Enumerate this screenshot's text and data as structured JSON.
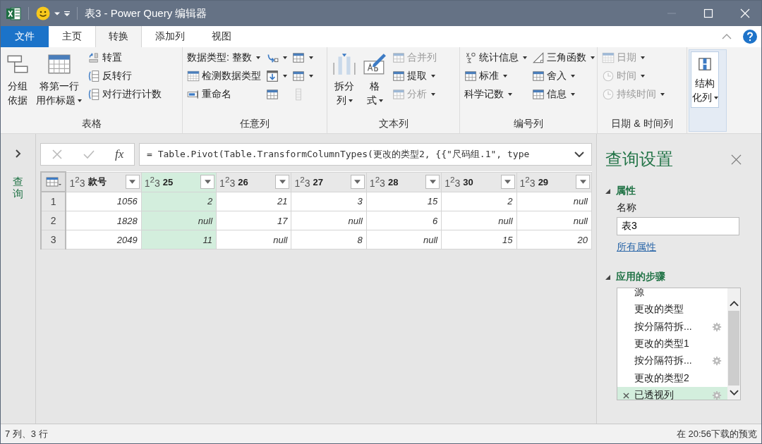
{
  "window": {
    "title": "表3 - Power Query 编辑器"
  },
  "tabs": [
    {
      "label": "文件",
      "kind": "file",
      "selected": false
    },
    {
      "label": "主页",
      "kind": "tab",
      "selected": false
    },
    {
      "label": "转换",
      "kind": "tab",
      "selected": true
    },
    {
      "label": "添加列",
      "kind": "tab",
      "selected": false
    },
    {
      "label": "视图",
      "kind": "tab",
      "selected": false
    }
  ],
  "ribbon": {
    "groups": [
      {
        "label": "表格",
        "highlighted": false,
        "columns": [
          [
            {
              "kind": "large",
              "lines": [
                "分组",
                "依据"
              ],
              "dropdown": false,
              "disabled": false
            }
          ],
          [
            {
              "kind": "large",
              "lines": [
                "将第一行",
                "用作标题"
              ],
              "dropdown": true,
              "disabled": false
            }
          ],
          [
            {
              "kind": "small",
              "label": "转置",
              "dropdown": false,
              "disabled": false
            },
            {
              "kind": "small",
              "label": "反转行",
              "dropdown": false,
              "disabled": false
            },
            {
              "kind": "small",
              "label": "对行进行计数",
              "dropdown": false,
              "disabled": false
            }
          ]
        ]
      },
      {
        "label": "任意列",
        "highlighted": false,
        "columns": [
          [
            {
              "kind": "small",
              "label": "数据类型: 整数",
              "dropdown": true,
              "disabled": false
            },
            {
              "kind": "small",
              "label": "检测数据类型",
              "dropdown": false,
              "disabled": false
            },
            {
              "kind": "small",
              "label": "重命名",
              "dropdown": false,
              "disabled": false
            }
          ],
          [
            {
              "kind": "icon",
              "dropdown": true,
              "disabled": false
            },
            {
              "kind": "icon",
              "dropdown": true,
              "disabled": false
            },
            {
              "kind": "icon",
              "dropdown": false,
              "disabled": false
            }
          ],
          [
            {
              "kind": "icon",
              "dropdown": true,
              "disabled": false
            },
            {
              "kind": "icon",
              "dropdown": true,
              "disabled": false
            },
            {
              "kind": "icon",
              "dropdown": false,
              "disabled": true
            }
          ]
        ]
      },
      {
        "label": "文本列",
        "highlighted": false,
        "columns": [
          [
            {
              "kind": "large",
              "lines": [
                "拆分",
                "列"
              ],
              "dropdown": true,
              "disabled": false
            }
          ],
          [
            {
              "kind": "large",
              "lines": [
                "格",
                "式"
              ],
              "dropdown": true,
              "disabled": false
            }
          ],
          [
            {
              "kind": "small",
              "label": "合并列",
              "dropdown": false,
              "disabled": true
            },
            {
              "kind": "small",
              "label": "提取",
              "dropdown": true,
              "disabled": false
            },
            {
              "kind": "small",
              "label": "分析",
              "dropdown": true,
              "disabled": true
            }
          ]
        ]
      },
      {
        "label": "编号列",
        "highlighted": false,
        "columns": [
          [
            {
              "kind": "small",
              "label": "统计信息",
              "dropdown": true,
              "disabled": false
            },
            {
              "kind": "small",
              "label": "标准",
              "dropdown": true,
              "disabled": false
            },
            {
              "kind": "small",
              "label": "科学记数",
              "dropdown": true,
              "disabled": false
            }
          ],
          [
            {
              "kind": "small",
              "label": "三角函数",
              "dropdown": true,
              "disabled": false
            },
            {
              "kind": "small",
              "label": "舍入",
              "dropdown": true,
              "disabled": false
            },
            {
              "kind": "small",
              "label": "信息",
              "dropdown": true,
              "disabled": false
            }
          ]
        ]
      },
      {
        "label": "日期 & 时间列",
        "highlighted": false,
        "columns": [
          [
            {
              "kind": "small",
              "label": "日期",
              "dropdown": true,
              "disabled": true
            },
            {
              "kind": "small",
              "label": "时间",
              "dropdown": true,
              "disabled": true
            },
            {
              "kind": "small",
              "label": "持续时间",
              "dropdown": true,
              "disabled": true
            }
          ]
        ]
      },
      {
        "highlighted": true,
        "columns": [
          [
            {
              "kind": "large",
              "lines": [
                "结构",
                "化列"
              ],
              "dropdown": true,
              "disabled": false
            }
          ]
        ]
      }
    ]
  },
  "queries_pane": {
    "label": "查询"
  },
  "formula_bar": {
    "fx": "fx",
    "formula": "= Table.Pivot(Table.TransformColumnTypes(更改的类型2, {{\"尺码组.1\", type"
  },
  "table": {
    "columns": [
      {
        "type_label": "1$^{2}$3",
        "name": "款号",
        "selected": false
      },
      {
        "type_label": "1$^{2}$3",
        "name": "25",
        "selected": true
      },
      {
        "type_label": "1$^{2}$3",
        "name": "26",
        "selected": false
      },
      {
        "type_label": "1$^{2}$3",
        "name": "27",
        "selected": false
      },
      {
        "type_label": "1$^{2}$3",
        "name": "28",
        "selected": false
      },
      {
        "type_label": "1$^{2}$3",
        "name": "30",
        "selected": false
      },
      {
        "type_label": "1$^{2}$3",
        "name": "29",
        "selected": false
      }
    ],
    "rows": [
      {
        "index": "1",
        "cells": [
          "1056",
          "2",
          "21",
          "3",
          "15",
          "2",
          "null"
        ]
      },
      {
        "index": "2",
        "cells": [
          "1828",
          "null",
          "17",
          "null",
          "6",
          "null",
          "null"
        ]
      },
      {
        "index": "3",
        "cells": [
          "2049",
          "11",
          "null",
          "8",
          "null",
          "15",
          "20"
        ]
      }
    ]
  },
  "query_settings": {
    "title": "查询设置",
    "properties": {
      "heading": "属性",
      "name_label": "名称",
      "name_value": "表3",
      "all_properties_link": "所有属性"
    },
    "steps": {
      "heading": "应用的步骤",
      "items": [
        {
          "label": "源",
          "settings": false,
          "selected": false
        },
        {
          "label": "更改的类型",
          "settings": false,
          "selected": false
        },
        {
          "label": "按分隔符拆...",
          "settings": true,
          "selected": false
        },
        {
          "label": "更改的类型1",
          "settings": false,
          "selected": false
        },
        {
          "label": "按分隔符拆...",
          "settings": true,
          "selected": false
        },
        {
          "label": "更改的类型2",
          "settings": false,
          "selected": false
        },
        {
          "label": "已透视列",
          "settings": true,
          "selected": true
        }
      ]
    }
  },
  "status_bar": {
    "left": "7 列、3 行",
    "right": "在 20:56下载的预览"
  }
}
